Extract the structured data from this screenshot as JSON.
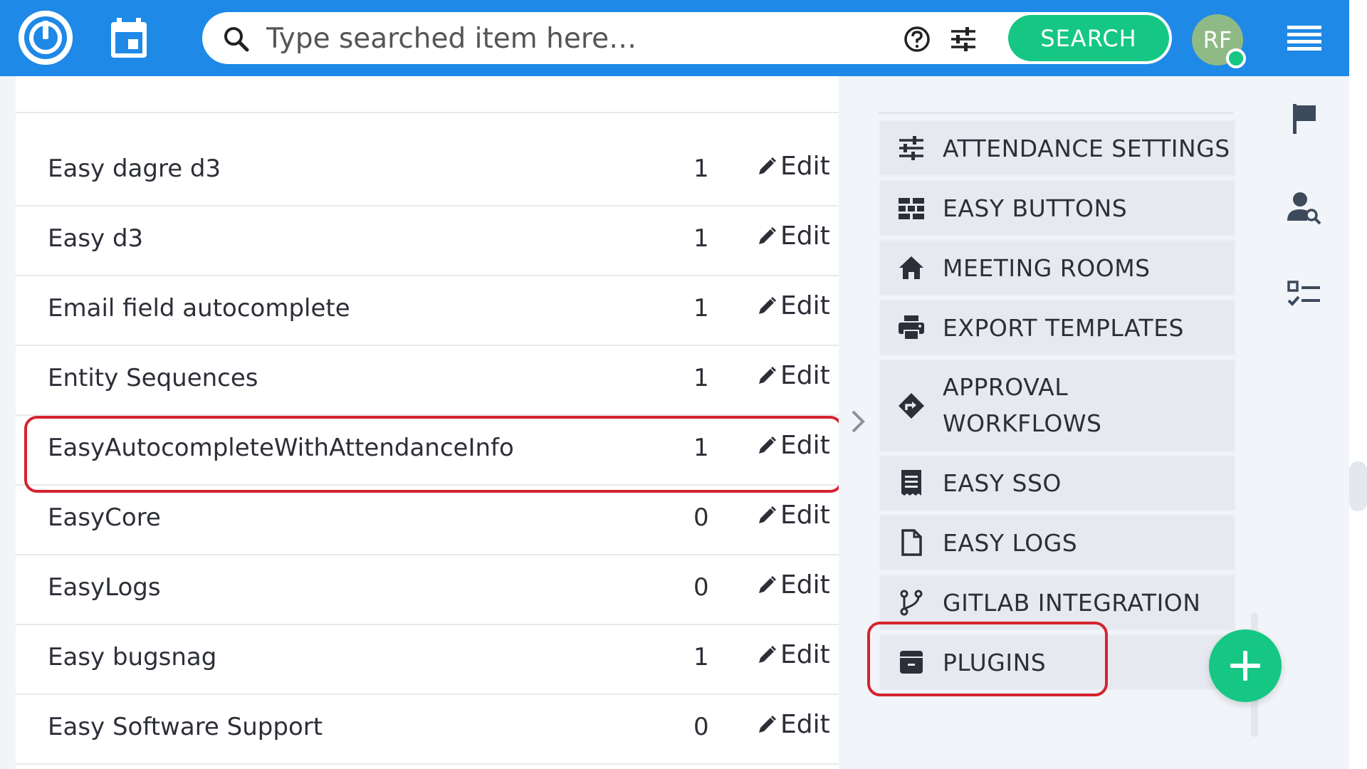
{
  "header": {
    "search_placeholder": "Type searched item here…",
    "search_button": "SEARCH",
    "avatar_initials": "RF",
    "brand_color": "#1e89e6",
    "accent_color": "#16c784"
  },
  "table": {
    "rows": [
      {
        "name": "Easy dagre d3",
        "count": "1",
        "edit": "Edit"
      },
      {
        "name": "Easy d3",
        "count": "1",
        "edit": "Edit"
      },
      {
        "name": "Email field autocomplete",
        "count": "1",
        "edit": "Edit"
      },
      {
        "name": "Entity Sequences",
        "count": "1",
        "edit": "Edit"
      },
      {
        "name": "EasyAutocompleteWithAttendanceInfo",
        "count": "1",
        "edit": "Edit"
      },
      {
        "name": "EasyCore",
        "count": "0",
        "edit": "Edit"
      },
      {
        "name": "EasyLogs",
        "count": "0",
        "edit": "Edit"
      },
      {
        "name": "Easy bugsnag",
        "count": "1",
        "edit": "Edit"
      },
      {
        "name": "Easy Software Support",
        "count": "0",
        "edit": "Edit"
      }
    ],
    "highlight_color": "#d6232f"
  },
  "side_menu": {
    "items": [
      {
        "label": "ATTENDANCE SETTINGS",
        "icon": "sliders-icon"
      },
      {
        "label": "EASY BUTTONS",
        "icon": "buttons-grid-icon"
      },
      {
        "label": "MEETING ROOMS",
        "icon": "home-icon"
      },
      {
        "label": "EXPORT TEMPLATES",
        "icon": "printer-icon"
      },
      {
        "label": "APPROVAL",
        "label2": "WORKFLOWS",
        "icon": "route-diamond-icon"
      },
      {
        "label": "EASY SSO",
        "icon": "receipt-icon"
      },
      {
        "label": "EASY LOGS",
        "icon": "file-icon"
      },
      {
        "label": "GITLAB INTEGRATION",
        "icon": "branch-icon"
      },
      {
        "label": "PLUGINS",
        "icon": "archive-icon"
      }
    ]
  }
}
